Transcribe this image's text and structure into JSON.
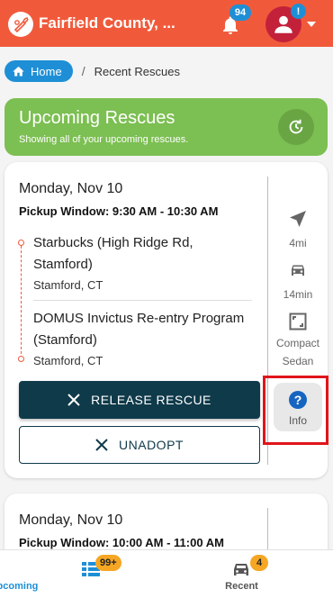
{
  "header": {
    "title": "Fairfield County, ...",
    "notification_count": "94",
    "avatar_badge": "!",
    "colors": {
      "header_bg": "#f05a3b",
      "badge": "#1e8fd6",
      "avatar": "#c3213a"
    },
    "icons": {
      "logo": "carrot-logo-icon",
      "bell": "bell-icon",
      "avatar": "user-icon",
      "dropdown": "caret-down-icon"
    }
  },
  "breadcrumb": {
    "home_label": "Home",
    "separator": "/",
    "current": "Recent Rescues"
  },
  "banner": {
    "title": "Upcoming Rescues",
    "subtitle": "Showing all of your upcoming rescues.",
    "color": "#7cbf52",
    "refresh_icon": "refresh-clock-icon"
  },
  "rescues": [
    {
      "date": "Monday, Nov 10",
      "pickup_window": "Pickup Window: 9:30 AM - 10:30 AM",
      "pickup": {
        "name": "Starbucks (High Ridge Rd, Stamford)",
        "city": "Stamford, CT"
      },
      "dropoff": {
        "name": "DOMUS Invictus Re-entry Program (Stamford)",
        "city": "Stamford, CT"
      },
      "distance": "4mi",
      "duration": "14min",
      "vehicle": "Compact Sedan",
      "info_label": "Info",
      "release_label": "RELEASE RESCUE",
      "unadopt_label": "UNADOPT"
    },
    {
      "date": "Monday, Nov 10",
      "pickup_window": "Pickup Window: 10:00 AM - 11:00 AM"
    }
  ],
  "bottom_nav": {
    "upcoming": {
      "label": "Upcoming",
      "badge": "99+",
      "active": true
    },
    "recent": {
      "label": "Recent",
      "badge": "4",
      "active": false
    }
  }
}
